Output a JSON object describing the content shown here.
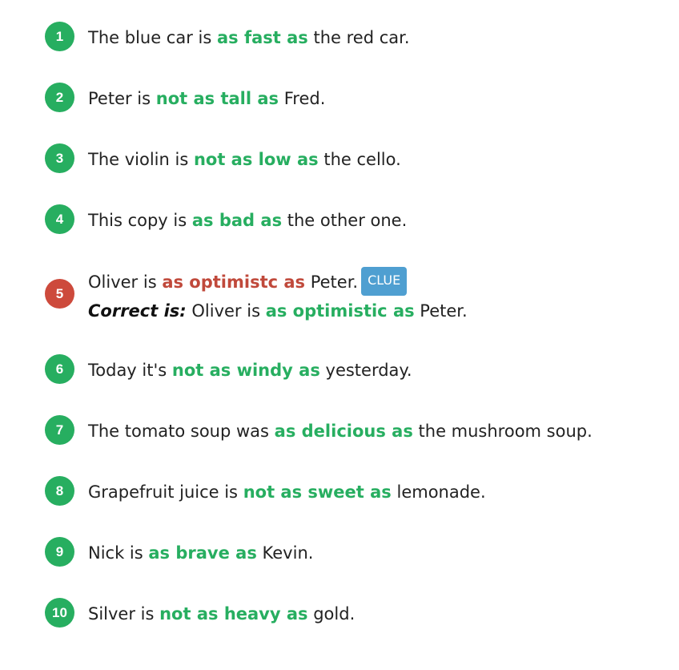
{
  "exercises": [
    {
      "number": "1",
      "before": "The blue car is ",
      "answer": "as fast as",
      "after": " the red car."
    },
    {
      "number": "2",
      "before": "Peter is ",
      "answer": "not as tall as",
      "after": " Fred."
    },
    {
      "number": "3",
      "before": "The violin is ",
      "answer": "not as low as",
      "after": " the cello."
    },
    {
      "number": "4",
      "before": "This copy is ",
      "answer": "as bad as",
      "after": " the other one."
    },
    {
      "number": "5",
      "before": "Oliver is ",
      "answer": "as optimistc as",
      "after": " Peter.",
      "clue_label": "CLUE",
      "correct_label": "Correct is:",
      "correct_before": " Oliver is ",
      "correct_answer": "as optimistic as",
      "correct_after": " Peter."
    },
    {
      "number": "6",
      "before": "Today it's ",
      "answer": "not as windy as",
      "after": " yesterday."
    },
    {
      "number": "7",
      "before": "The tomato soup was ",
      "answer": "as delicious as",
      "after": " the mushroom soup."
    },
    {
      "number": "8",
      "before": "Grapefruit juice is ",
      "answer": "not as sweet as",
      "after": " lemonade."
    },
    {
      "number": "9",
      "before": "Nick is ",
      "answer": "as brave as",
      "after": " Kevin."
    },
    {
      "number": "10",
      "before": "Silver is ",
      "answer": "not as heavy as",
      "after": " gold."
    }
  ],
  "colors": {
    "correct": "#27ae60",
    "incorrect": "#c0493b",
    "clue_button": "#4f9fd1"
  }
}
